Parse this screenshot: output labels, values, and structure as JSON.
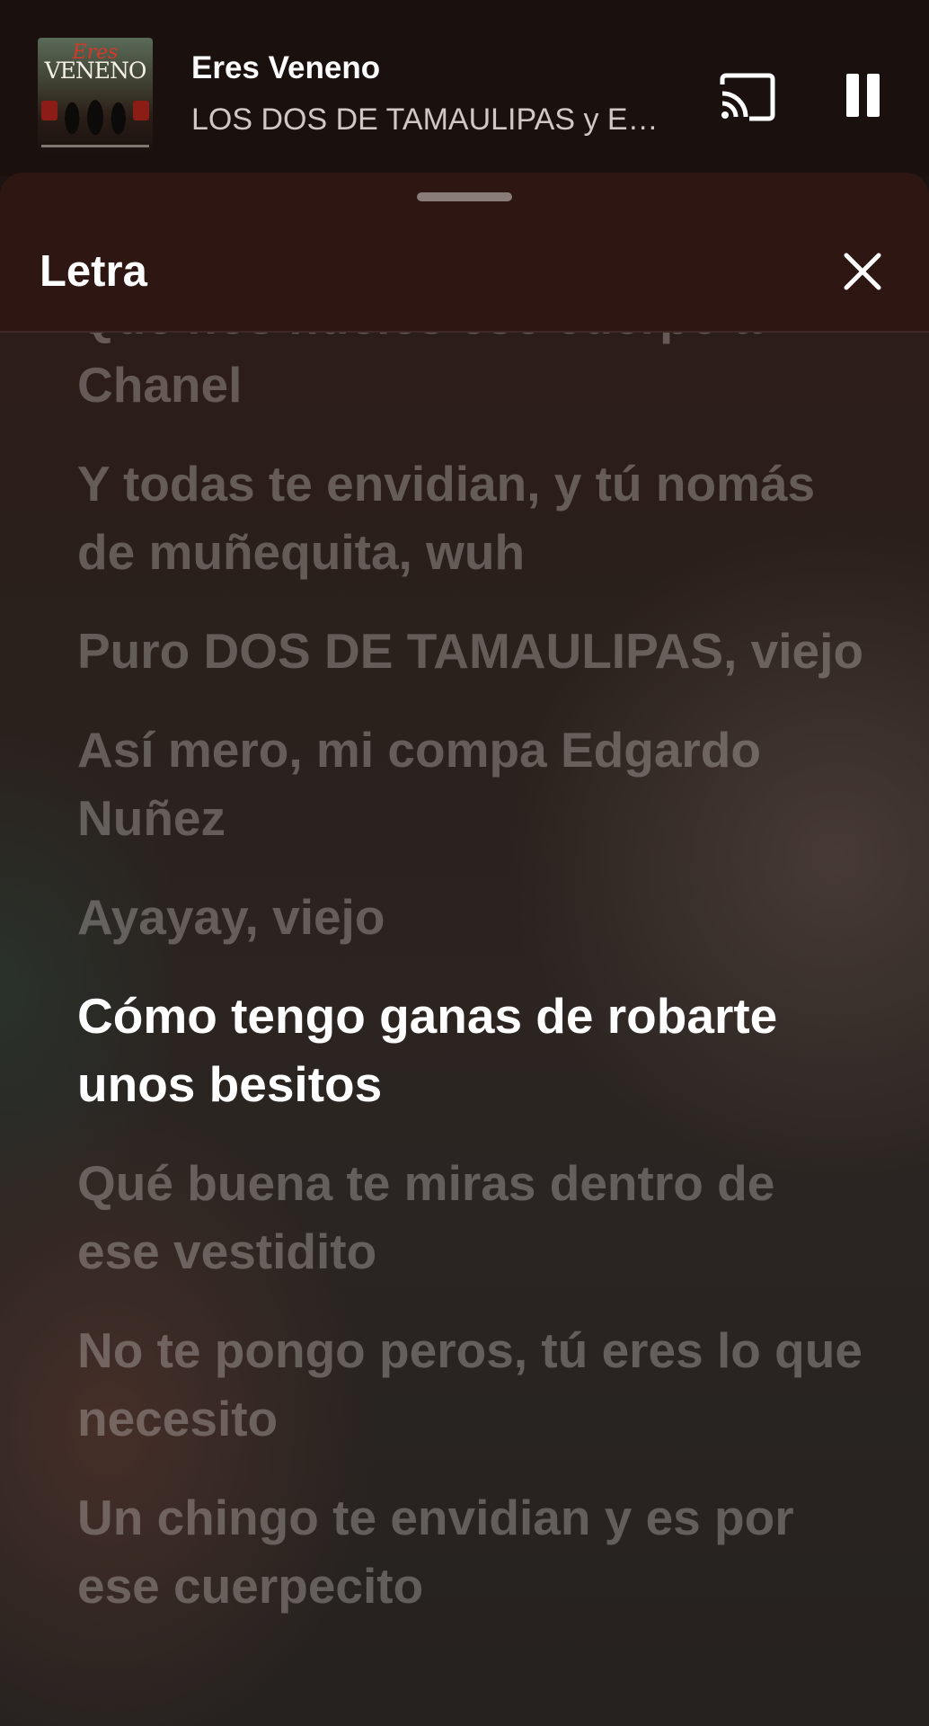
{
  "now_playing": {
    "album_art_script": "Eres",
    "album_art_title": "VENENO",
    "title": "Eres Veneno",
    "artist": "LOS DOS DE TAMAULIPAS y Edgardo Nuñez"
  },
  "lyrics_sheet": {
    "title": "Letra",
    "partial_line": "Que nos hueles ese cuerpo a Chanel",
    "lines": [
      "Y todas te envidian, y tú nomás de muñequita, wuh",
      "Puro DOS DE TAMAULIPAS, viejo",
      "Así mero, mi compa Edgardo Nuñez",
      "Ayayay, viejo",
      "Cómo tengo ganas de robarte unos besitos",
      "Qué buena te miras dentro de ese vestidito",
      "No te pongo peros, tú eres lo que necesito",
      "Un chingo te envidian y es por ese cuerpecito"
    ],
    "active_line_index": 4
  },
  "icons": {
    "cast": "cast-icon",
    "pause": "pause-icon",
    "close": "close-icon"
  },
  "colors": {
    "header_bg": "#2e1612",
    "miniplayer_bg": "#1a100d",
    "inactive_lyric": "#cdc8c4",
    "active_lyric": "#ffffff"
  }
}
